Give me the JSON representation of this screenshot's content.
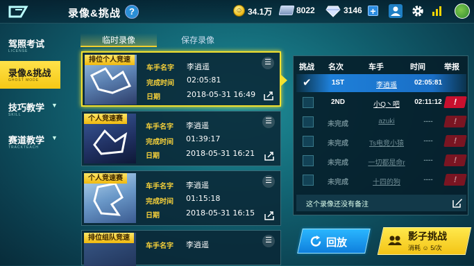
{
  "header": {
    "title": "录像&挑战",
    "help": "?",
    "coins": "34.1万",
    "tickets": "8022",
    "diamonds": "3146",
    "add": "+"
  },
  "sidebar": {
    "items": [
      {
        "label": "驾照考试",
        "sub": "LICENSE",
        "active": false,
        "caret": ""
      },
      {
        "label": "录像&挑战",
        "sub": "GHOST MODE",
        "active": true,
        "caret": ""
      },
      {
        "label": "技巧教学",
        "sub": "SKILL",
        "active": false,
        "caret": "▼"
      },
      {
        "label": "赛道教学",
        "sub": "TRACKTEACH",
        "active": false,
        "caret": "▼"
      }
    ]
  },
  "tabs": {
    "temp": "临时录像",
    "saved": "保存录像"
  },
  "records": [
    {
      "badge": "排位个人竞速",
      "name_label": "车手名字",
      "name": "李逍遥",
      "time_label": "完成时间",
      "time": "02:05:81",
      "date_label": "日期",
      "date": "2018-05-31  16:49"
    },
    {
      "badge": "个人竞速赛",
      "name_label": "车手名字",
      "name": "李逍遥",
      "time_label": "完成时间",
      "time": "01:39:17",
      "date_label": "日期",
      "date": "2018-05-31  16:21"
    },
    {
      "badge": "个人竞速赛",
      "name_label": "车手名字",
      "name": "李逍遥",
      "time_label": "完成时间",
      "time": "01:15:18",
      "date_label": "日期",
      "date": "2018-05-31  16:15"
    },
    {
      "badge": "排位组队竞速",
      "name_label": "车手名字",
      "name": "李逍遥",
      "time_label": "",
      "time": "",
      "date_label": "",
      "date": ""
    }
  ],
  "ranking": {
    "headers": {
      "challenge": "挑战",
      "rank": "名次",
      "driver": "车手",
      "time": "时间",
      "report": "举报"
    },
    "rows": [
      {
        "rank": "1ST",
        "driver": "李逍遥",
        "time": "02:05:81",
        "checked": true,
        "highlight": true,
        "report": false
      },
      {
        "rank": "2ND",
        "driver": "小Q丶吧",
        "time": "02:11:12",
        "checked": false,
        "highlight": false,
        "report": true
      },
      {
        "rank": "未完成",
        "driver": "azuki",
        "time": "----",
        "checked": false,
        "highlight": false,
        "report": true
      },
      {
        "rank": "未完成",
        "driver": "Ts电竞小猿",
        "time": "----",
        "checked": false,
        "highlight": false,
        "report": true
      },
      {
        "rank": "未完成",
        "driver": "一切都是命r",
        "time": "----",
        "checked": false,
        "highlight": false,
        "report": true
      },
      {
        "rank": "未完成",
        "driver": "十四的狗",
        "time": "----",
        "checked": false,
        "highlight": false,
        "report": true
      }
    ],
    "report_glyph": "!",
    "note": "这个录像还没有备注"
  },
  "actions": {
    "replay": "回放",
    "ghost": "影子挑战",
    "ghost_cost_prefix": "消耗",
    "ghost_cost": "5",
    "ghost_cost_suffix": "/次"
  },
  "colors": {
    "accent_yellow": "#f2cf2e",
    "accent_blue": "#1e7fd8",
    "report_red": "#c8102e"
  }
}
